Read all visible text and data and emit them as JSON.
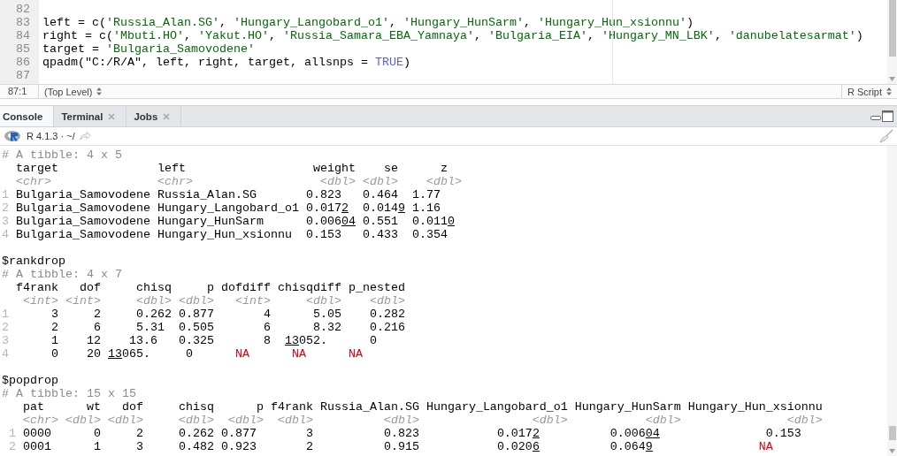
{
  "editor": {
    "lines": [
      {
        "number": "82"
      },
      {
        "number": "83",
        "segments": [
          {
            "text": "left = c(",
            "kind": "plain"
          },
          {
            "text": "'Russia_Alan.SG'",
            "kind": "string"
          },
          {
            "text": ", ",
            "kind": "plain"
          },
          {
            "text": "'Hungary_Langobard_o1'",
            "kind": "string"
          },
          {
            "text": ", ",
            "kind": "plain"
          },
          {
            "text": "'Hungary_HunSarm'",
            "kind": "string"
          },
          {
            "text": ", ",
            "kind": "plain"
          },
          {
            "text": "'Hungary_Hun_xsionnu'",
            "kind": "string"
          },
          {
            "text": ")",
            "kind": "plain"
          }
        ]
      },
      {
        "number": "84",
        "segments": [
          {
            "text": "right = c(",
            "kind": "plain"
          },
          {
            "text": "'Mbuti.HO'",
            "kind": "string"
          },
          {
            "text": ", ",
            "kind": "plain"
          },
          {
            "text": "'Yakut.HO'",
            "kind": "string"
          },
          {
            "text": ", ",
            "kind": "plain"
          },
          {
            "text": "'Russia_Samara_EBA_Yamnaya'",
            "kind": "string"
          },
          {
            "text": ", ",
            "kind": "plain"
          },
          {
            "text": "'Bulgaria_EIA'",
            "kind": "string"
          },
          {
            "text": ", ",
            "kind": "plain"
          },
          {
            "text": "'Hungary_MN_LBK'",
            "kind": "string"
          },
          {
            "text": ", ",
            "kind": "plain"
          },
          {
            "text": "'danubelatesarmat'",
            "kind": "string"
          },
          {
            "text": ")",
            "kind": "plain"
          }
        ]
      },
      {
        "number": "85",
        "segments": [
          {
            "text": "target = ",
            "kind": "plain"
          },
          {
            "text": "'Bulgaria_Samovodene'",
            "kind": "string"
          }
        ]
      },
      {
        "number": "86",
        "segments": [
          {
            "text": "qpadm(\"C:/R/A\", left, right, target, allsnps = ",
            "kind": "plain"
          },
          {
            "text": "TRUE",
            "kind": "constant"
          },
          {
            "text": ")",
            "kind": "plain"
          }
        ]
      },
      {
        "number": "87"
      }
    ]
  },
  "status_bar": {
    "position": "87:1",
    "scope": "(Top Level)",
    "file_type": "R Script"
  },
  "console_pane": {
    "tabs": [
      {
        "label": "Console",
        "selected": true,
        "closable": false
      },
      {
        "label": "Terminal",
        "selected": false,
        "closable": true
      },
      {
        "label": "Jobs",
        "selected": false,
        "closable": true
      }
    ],
    "version": "R 4.1.3 · ~/",
    "lines": [
      {
        "kind": "text",
        "segments": [
          {
            "text": "# A tibble: 4 x 5",
            "kind": "comment"
          }
        ]
      },
      {
        "kind": "text",
        "segments": [
          {
            "text": "  target              left                  weight    se      z",
            "kind": "plain"
          }
        ]
      },
      {
        "kind": "text",
        "segments": [
          {
            "text": "  <chr>               <chr>                  <dbl> <dbl>    <dbl>",
            "kind": "type"
          }
        ]
      },
      {
        "kind": "text",
        "segments": [
          {
            "text": "1",
            "kind": "rownum"
          },
          {
            "text": " Bulgaria_Samovodene Russia_Alan.SG       0.823   0.464  1.77",
            "kind": "plain"
          }
        ]
      },
      {
        "kind": "text",
        "segments": [
          {
            "text": "2",
            "kind": "rownum"
          },
          {
            "text": " Bulgaria_Samovodene Hungary_Langobard_o1 0.017",
            "kind": "plain"
          },
          {
            "text": "2",
            "kind": "underline"
          },
          {
            "text": "  0.014",
            "kind": "plain"
          },
          {
            "text": "9",
            "kind": "underline"
          },
          {
            "text": " 1.16",
            "kind": "plain"
          }
        ]
      },
      {
        "kind": "text",
        "segments": [
          {
            "text": "3",
            "kind": "rownum"
          },
          {
            "text": " Bulgaria_Samovodene Hungary_HunSarm      0.006",
            "kind": "plain"
          },
          {
            "text": "04",
            "kind": "underline"
          },
          {
            "text": " 0.551  0.011",
            "kind": "plain"
          },
          {
            "text": "0",
            "kind": "underline"
          }
        ]
      },
      {
        "kind": "text",
        "segments": [
          {
            "text": "4",
            "kind": "rownum"
          },
          {
            "text": " Bulgaria_Samovodene Hungary_Hun_xsionnu  0.153   0.433  0.354",
            "kind": "plain"
          }
        ]
      },
      {
        "kind": "blank"
      },
      {
        "kind": "text",
        "segments": [
          {
            "text": "$rankdrop",
            "kind": "plain"
          }
        ]
      },
      {
        "kind": "text",
        "segments": [
          {
            "text": "# A tibble: 4 x 7",
            "kind": "comment"
          }
        ]
      },
      {
        "kind": "text",
        "segments": [
          {
            "text": "  f4rank   dof     chisq     p dofdiff chisqdiff p_nested",
            "kind": "plain"
          }
        ]
      },
      {
        "kind": "text",
        "segments": [
          {
            "text": "   <int> <int>     <dbl> <dbl>   <int>     <dbl>    <dbl>",
            "kind": "type"
          }
        ]
      },
      {
        "kind": "text",
        "segments": [
          {
            "text": "1",
            "kind": "rownum"
          },
          {
            "text": "      3     2     0.262 0.877       4      5.05    0.282",
            "kind": "plain"
          }
        ]
      },
      {
        "kind": "text",
        "segments": [
          {
            "text": "2",
            "kind": "rownum"
          },
          {
            "text": "      2     6     5.31  0.505       6      8.32    0.216",
            "kind": "plain"
          }
        ]
      },
      {
        "kind": "text",
        "segments": [
          {
            "text": "3",
            "kind": "rownum"
          },
          {
            "text": "      1    12    13.6   0.325       8  ",
            "kind": "plain"
          },
          {
            "text": "13",
            "kind": "underline"
          },
          {
            "text": "052.      0",
            "kind": "plain"
          }
        ]
      },
      {
        "kind": "text",
        "segments": [
          {
            "text": "4",
            "kind": "rownum"
          },
          {
            "text": "      0    20 ",
            "kind": "plain"
          },
          {
            "text": "13",
            "kind": "underline"
          },
          {
            "text": "065.     0",
            "kind": "plain"
          },
          {
            "text": "      NA",
            "kind": "na"
          },
          {
            "text": "      NA",
            "kind": "na"
          },
          {
            "text": "      NA",
            "kind": "na"
          }
        ]
      },
      {
        "kind": "blank"
      },
      {
        "kind": "text",
        "segments": [
          {
            "text": "$popdrop",
            "kind": "plain"
          }
        ]
      },
      {
        "kind": "text",
        "segments": [
          {
            "text": "# A tibble: 15 x 15",
            "kind": "comment"
          }
        ]
      },
      {
        "kind": "text",
        "segments": [
          {
            "text": "   pat      wt   dof     chisq      p f4rank Russia_Alan.SG Hungary_Langobard_o1 Hungary_HunSarm Hungary_Hun_xsionnu",
            "kind": "plain"
          }
        ]
      },
      {
        "kind": "text",
        "segments": [
          {
            "text": "   <chr> <dbl> <dbl>     <dbl>  <dbl>  <dbl>          <dbl>                <dbl>           <dbl>               <dbl>",
            "kind": "type"
          }
        ]
      },
      {
        "kind": "text",
        "segments": [
          {
            "text": " 1",
            "kind": "rownum"
          },
          {
            "text": " 0000      0     2     0.262 0.877       3          0.823           0.017",
            "kind": "plain"
          },
          {
            "text": "2",
            "kind": "underline"
          },
          {
            "text": "          0.006",
            "kind": "plain"
          },
          {
            "text": "04",
            "kind": "underline"
          },
          {
            "text": "               0.153",
            "kind": "plain"
          }
        ]
      },
      {
        "kind": "text",
        "segments": [
          {
            "text": " 2",
            "kind": "rownum"
          },
          {
            "text": " 0001      1     3     0.482 0.923       2          0.915           0.020",
            "kind": "plain"
          },
          {
            "text": "6",
            "kind": "underline"
          },
          {
            "text": "          0.064",
            "kind": "plain"
          },
          {
            "text": "9",
            "kind": "underline"
          },
          {
            "text": "               NA",
            "kind": "na"
          }
        ]
      }
    ]
  }
}
